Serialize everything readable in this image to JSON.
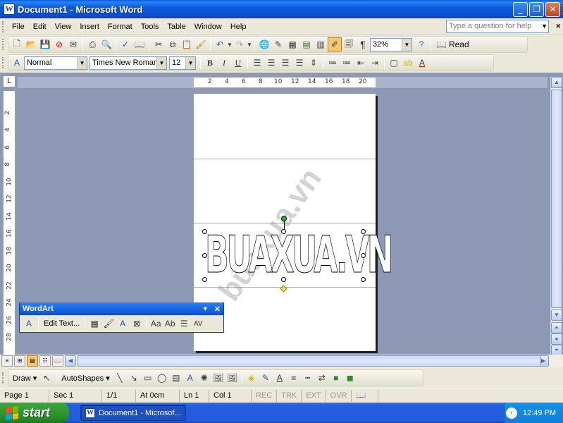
{
  "window": {
    "title": "Document1 - Microsoft Word"
  },
  "menu": {
    "items": [
      "File",
      "Edit",
      "View",
      "Insert",
      "Format",
      "Tools",
      "Table",
      "Window",
      "Help"
    ],
    "help_placeholder": "Type a question for help"
  },
  "standard_toolbar": {
    "zoom": "32%",
    "read_label": "Read"
  },
  "formatting_toolbar": {
    "style": "Normal",
    "font": "Times New Roman",
    "size": "12"
  },
  "ruler": {
    "h_ticks": [
      "2",
      "4",
      "6",
      "8",
      "10",
      "12",
      "14",
      "16",
      "18",
      "20"
    ],
    "v_ticks": [
      "2",
      "4",
      "6",
      "8",
      "10",
      "12",
      "14",
      "16",
      "18",
      "20",
      "22",
      "24",
      "26",
      "28"
    ]
  },
  "document": {
    "wordart_text": "BUAXUA.VN",
    "watermark": "buaxua.vn"
  },
  "wordart_toolbar": {
    "title": "WordArt",
    "edit_text_label": "Edit Text..."
  },
  "draw_toolbar": {
    "draw_label": "Draw",
    "autoshapes_label": "AutoShapes"
  },
  "status": {
    "page": "Page 1",
    "sec": "Sec 1",
    "pages": "1/1",
    "at": "At 0cm",
    "ln": "Ln 1",
    "col": "Col 1",
    "rec": "REC",
    "trk": "TRK",
    "ext": "EXT",
    "ovr": "OVR"
  },
  "taskbar": {
    "start_label": "start",
    "task_label": "Document1 - Microsof...",
    "clock": "12:49 PM"
  }
}
